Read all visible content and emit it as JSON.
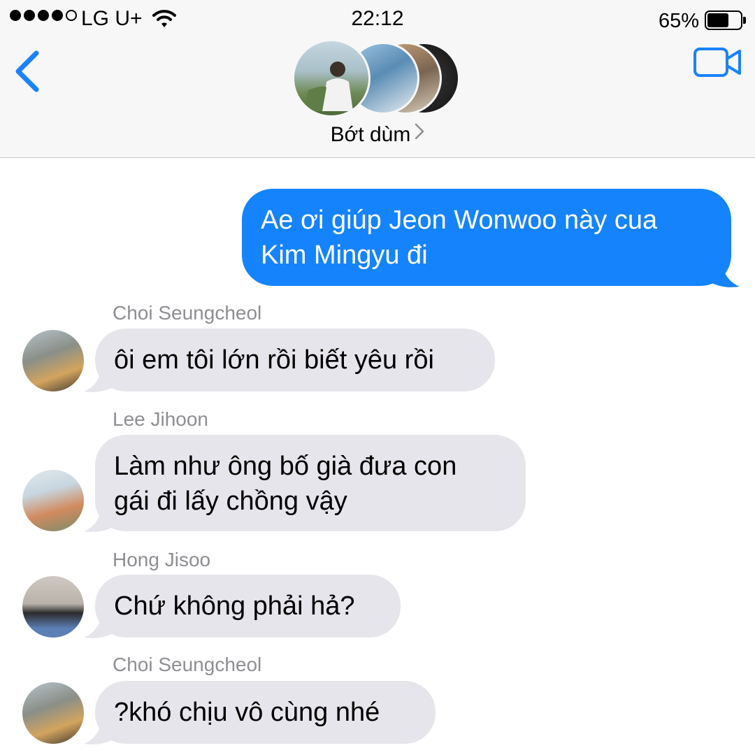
{
  "status_bar": {
    "carrier": "LG U+",
    "signal_bars_filled": 4,
    "signal_bars_total": 5,
    "time": "22:12",
    "battery_label": "65%",
    "battery_level": 0.65,
    "wifi_icon": "wifi-icon"
  },
  "header": {
    "back_icon": "chevron-left-icon",
    "video_icon": "video-camera-icon",
    "group_name": "Bớt dùm",
    "group_avatar_count": 4,
    "accent_color": "#1a82fb"
  },
  "messages": [
    {
      "direction": "outgoing",
      "lines": [
        "Ae ơi giúp Jeon Wonwoo này cua",
        "Kim Mingyu đi"
      ]
    },
    {
      "direction": "incoming",
      "sender": "Choi Seungcheol",
      "lines": [
        "ôi em tôi lớn rồi biết yêu rồi"
      ]
    },
    {
      "direction": "incoming",
      "sender": "Lee Jihoon",
      "lines": [
        "Làm như ông bố già đưa con",
        "gái đi lấy chồng vậy"
      ]
    },
    {
      "direction": "incoming",
      "sender": "Hong Jisoo",
      "lines": [
        "Chứ không phải hả?"
      ]
    },
    {
      "direction": "incoming",
      "sender": "Choi Seungcheol",
      "lines": [
        "?khó chịu vô cùng nhé"
      ]
    }
  ],
  "colors": {
    "outgoing_bubble": "#1583fb",
    "incoming_bubble": "#e6e5eb",
    "sender_name": "#8e8e93"
  }
}
